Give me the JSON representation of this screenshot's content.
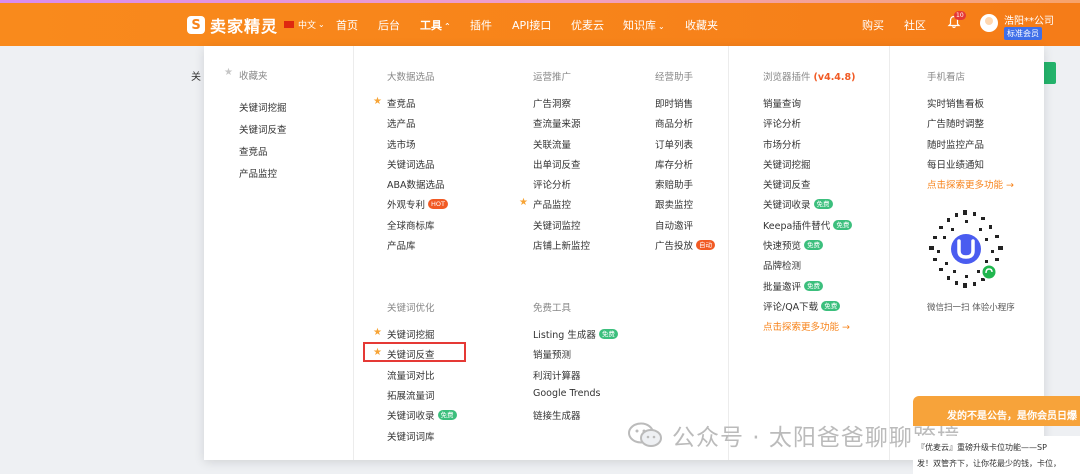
{
  "header": {
    "logo_text": "卖家精灵",
    "logo_mark": "S",
    "language": "中文",
    "nav": [
      "首页",
      "后台",
      "工具",
      "插件",
      "API接口",
      "优麦云",
      "知识库",
      "收藏夹"
    ],
    "right_nav": [
      "购买",
      "社区"
    ],
    "notification_count": "10",
    "user_name": "浩阳**公司",
    "member_label": "标准会员"
  },
  "background": {
    "left_text": "关"
  },
  "panel": {
    "favorites": {
      "title": "收藏夹",
      "items": [
        "关键词挖掘",
        "关键词反查",
        "查竞品",
        "产品监控"
      ]
    },
    "big_data": {
      "title": "大数据选品",
      "items": [
        "查竞品",
        "选产品",
        "选市场",
        "关键词选品",
        "ABA数据选品",
        "外观专利",
        "全球商标库",
        "产品库"
      ],
      "hot_tag": "HOT"
    },
    "keyword_opt": {
      "title": "关键词优化",
      "items": [
        "关键词挖掘",
        "关键词反查",
        "流量词对比",
        "拓展流量词",
        "关键词收录",
        "关键词词库"
      ]
    },
    "promo": {
      "title": "运营推广",
      "items": [
        "广告洞察",
        "查流量来源",
        "关联流量",
        "出单词反查",
        "评论分析",
        "产品监控",
        "关键词监控",
        "店铺上新监控"
      ]
    },
    "free_tools": {
      "title": "免费工具",
      "items": [
        "Listing 生成器",
        "销量预测",
        "利润计算器",
        "Google Trends",
        "链接生成器"
      ]
    },
    "ops_assistant": {
      "title": "经营助手",
      "items": [
        "即时销售",
        "商品分析",
        "订单列表",
        "库存分析",
        "索赔助手",
        "跟卖监控",
        "自动邀评",
        "广告投放"
      ],
      "auto_tag": "自动"
    },
    "browser_plugin": {
      "title": "浏览器插件",
      "version": "(v4.4.8)",
      "items": [
        "销量查询",
        "评论分析",
        "市场分析",
        "关键词挖掘",
        "关键词反查",
        "关键词收录",
        "Keepa插件替代",
        "快速预览",
        "品牌检测",
        "批量邀评",
        "评论/QA下载"
      ],
      "more": "点击探索更多功能 →"
    },
    "mobile": {
      "title": "手机看店",
      "items": [
        "实时销售看板",
        "广告随时调整",
        "随时监控产品",
        "每日业绩通知"
      ],
      "more": "点击探索更多功能 →",
      "qr_caption": "微信扫一扫 体验小程序"
    },
    "free_tag": "免费"
  },
  "watermark": "公众号 · 太阳爸爸聊聊跨境",
  "notice": {
    "headline": "发的不是公告，是你会员日爆",
    "line1": "『优麦云』重磅升级卡位功能——SP",
    "line2": "发！双管齐下，让你花最少的钱，卡位，"
  },
  "colors": {
    "brand_orange": "#f7831a",
    "star": "#f7a436",
    "free_tag": "#3cbf7d",
    "hot_tag": "#f15a24",
    "highlight_box": "#e53935",
    "member_badge": "#3f6fe8"
  }
}
